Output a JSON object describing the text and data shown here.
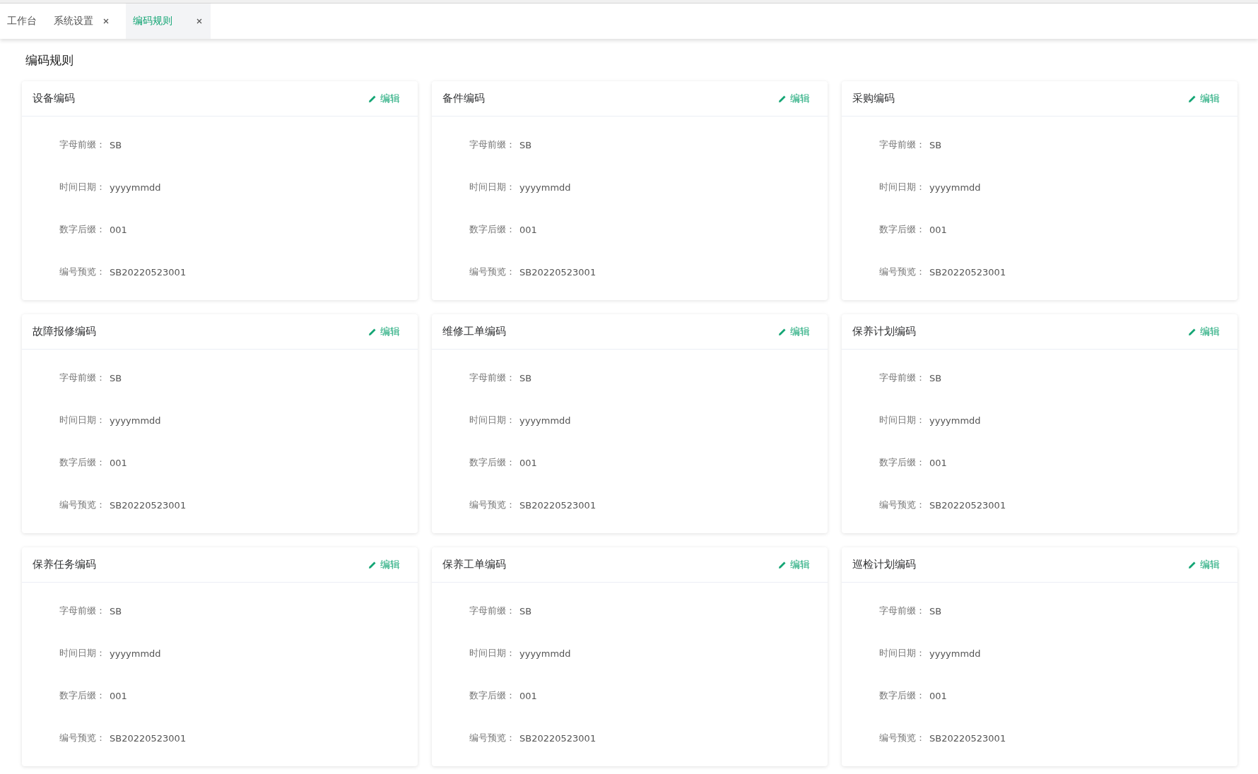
{
  "tabs": [
    {
      "label": "工作台",
      "closable": false,
      "selected": false
    },
    {
      "label": "系统设置",
      "closable": true,
      "selected": false
    },
    {
      "label": "编码规则",
      "closable": true,
      "selected": true
    }
  ],
  "page_title": "编码规则",
  "cards": [
    {
      "title": "设备编码",
      "edit_label": "编辑",
      "fields": [
        {
          "label": "字母前缀：",
          "value": "SB"
        },
        {
          "label": "时间日期：",
          "value": "yyyymmdd"
        },
        {
          "label": "数字后缀：",
          "value": "001"
        },
        {
          "label": "编号预览：",
          "value": "SB20220523001"
        }
      ]
    },
    {
      "title": "备件编码",
      "edit_label": "编辑",
      "fields": [
        {
          "label": "字母前缀：",
          "value": "SB"
        },
        {
          "label": "时间日期：",
          "value": "yyyymmdd"
        },
        {
          "label": "数字后缀：",
          "value": "001"
        },
        {
          "label": "编号预览：",
          "value": "SB20220523001"
        }
      ]
    },
    {
      "title": "采购编码",
      "edit_label": "编辑",
      "fields": [
        {
          "label": "字母前缀：",
          "value": "SB"
        },
        {
          "label": "时间日期：",
          "value": "yyyymmdd"
        },
        {
          "label": "数字后缀：",
          "value": "001"
        },
        {
          "label": "编号预览：",
          "value": "SB20220523001"
        }
      ]
    },
    {
      "title": "故障报修编码",
      "edit_label": "编辑",
      "fields": [
        {
          "label": "字母前缀：",
          "value": "SB"
        },
        {
          "label": "时间日期：",
          "value": "yyyymmdd"
        },
        {
          "label": "数字后缀：",
          "value": "001"
        },
        {
          "label": "编号预览：",
          "value": "SB20220523001"
        }
      ]
    },
    {
      "title": "维修工单编码",
      "edit_label": "编辑",
      "fields": [
        {
          "label": "字母前缀：",
          "value": "SB"
        },
        {
          "label": "时间日期：",
          "value": "yyyymmdd"
        },
        {
          "label": "数字后缀：",
          "value": "001"
        },
        {
          "label": "编号预览：",
          "value": "SB20220523001"
        }
      ]
    },
    {
      "title": "保养计划编码",
      "edit_label": "编辑",
      "fields": [
        {
          "label": "字母前缀：",
          "value": "SB"
        },
        {
          "label": "时间日期：",
          "value": "yyyymmdd"
        },
        {
          "label": "数字后缀：",
          "value": "001"
        },
        {
          "label": "编号预览：",
          "value": "SB20220523001"
        }
      ]
    },
    {
      "title": "保养任务编码",
      "edit_label": "编辑",
      "fields": [
        {
          "label": "字母前缀：",
          "value": "SB"
        },
        {
          "label": "时间日期：",
          "value": "yyyymmdd"
        },
        {
          "label": "数字后缀：",
          "value": "001"
        },
        {
          "label": "编号预览：",
          "value": "SB20220523001"
        }
      ]
    },
    {
      "title": "保养工单编码",
      "edit_label": "编辑",
      "fields": [
        {
          "label": "字母前缀：",
          "value": "SB"
        },
        {
          "label": "时间日期：",
          "value": "yyyymmdd"
        },
        {
          "label": "数字后缀：",
          "value": "001"
        },
        {
          "label": "编号预览：",
          "value": "SB20220523001"
        }
      ]
    },
    {
      "title": "巡检计划编码",
      "edit_label": "编辑",
      "fields": [
        {
          "label": "字母前缀：",
          "value": "SB"
        },
        {
          "label": "时间日期：",
          "value": "yyyymmdd"
        },
        {
          "label": "数字后缀：",
          "value": "001"
        },
        {
          "label": "编号预览：",
          "value": "SB20220523001"
        }
      ]
    }
  ]
}
